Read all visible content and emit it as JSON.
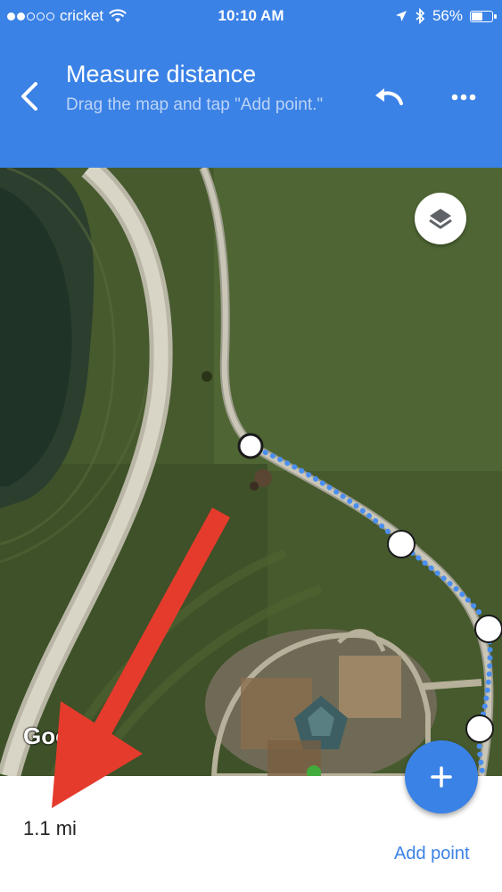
{
  "status_bar": {
    "carrier": "cricket",
    "time": "10:10 AM",
    "battery": "56%",
    "battery_level": 0.56,
    "signal_bars_filled": 2,
    "signal_bars_total": 5,
    "icons": [
      "wifi-icon",
      "location-arrow-icon",
      "bluetooth-icon",
      "battery-icon"
    ]
  },
  "app_bar": {
    "title": "Measure distance",
    "subtitle": "Drag the map and tap \"Add point.\"",
    "icons": [
      "back-arrow-icon",
      "undo-icon",
      "more-dots-icon"
    ],
    "color": "#3b82e6"
  },
  "map": {
    "type": "satellite",
    "attribution": "Google",
    "layers_icon": "layers-icon",
    "route_color": "#4a8ff0",
    "points_count": 5
  },
  "bottom_panel": {
    "distance": "1.1 mi",
    "add_point_label": "Add point",
    "fab_icon": "plus-icon"
  },
  "annotation": {
    "arrow_color": "#e53b2c",
    "target": "distance"
  }
}
